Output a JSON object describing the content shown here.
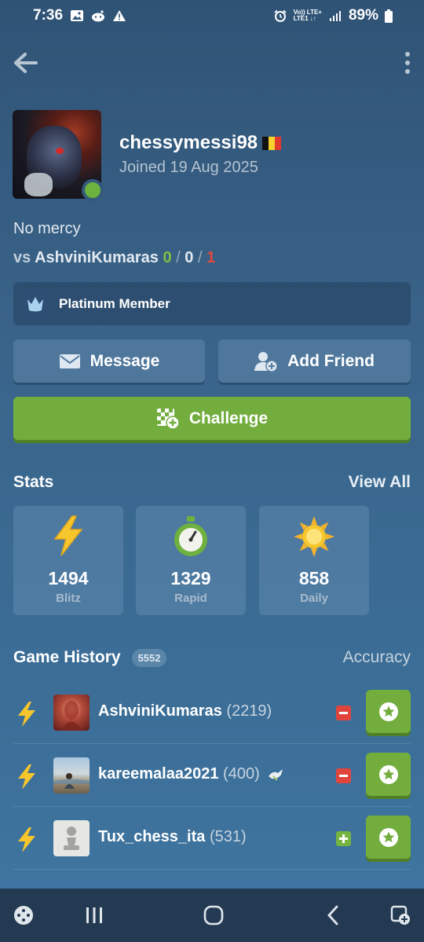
{
  "status_bar": {
    "time": "7:36",
    "network_top": "Vo)) LTE+",
    "network_bottom": "LTE1 ↓↑",
    "battery": "89%"
  },
  "profile": {
    "username": "chessymessi98",
    "country_flag": "belgium-flag",
    "joined": "Joined 19 Aug 2025",
    "bio": "No mercy",
    "vs_prefix": "vs",
    "vs_opponent": "AshviniKumaras",
    "vs_wins": "0",
    "vs_draws": "0",
    "vs_losses": "1",
    "separator": "/",
    "membership": "Platinum Member",
    "online": true
  },
  "actions": {
    "message": "Message",
    "add_friend": "Add Friend",
    "challenge": "Challenge"
  },
  "stats": {
    "title": "Stats",
    "view_all": "View All",
    "cards": [
      {
        "icon": "lightning-icon",
        "rating": "1494",
        "mode": "Blitz"
      },
      {
        "icon": "stopwatch-icon",
        "rating": "1329",
        "mode": "Rapid"
      },
      {
        "icon": "sun-icon",
        "rating": "858",
        "mode": "Daily"
      }
    ]
  },
  "history": {
    "title": "Game History",
    "count": "5552",
    "accuracy_label": "Accuracy",
    "games": [
      {
        "opponent": "AshviniKumaras",
        "rating": "(2219)",
        "result": "loss",
        "time_control": "blitz"
      },
      {
        "opponent": "kareemalaa2021",
        "rating": "(400)",
        "result": "loss",
        "time_control": "blitz",
        "extra_icon": "dove-icon"
      },
      {
        "opponent": "Tux_chess_ita",
        "rating": "(531)",
        "result": "win",
        "time_control": "blitz"
      }
    ]
  },
  "colors": {
    "background": "#3a6389",
    "accent_green": "#72ad3d",
    "loss_red": "#e0443a",
    "win_green": "#7dc042"
  }
}
